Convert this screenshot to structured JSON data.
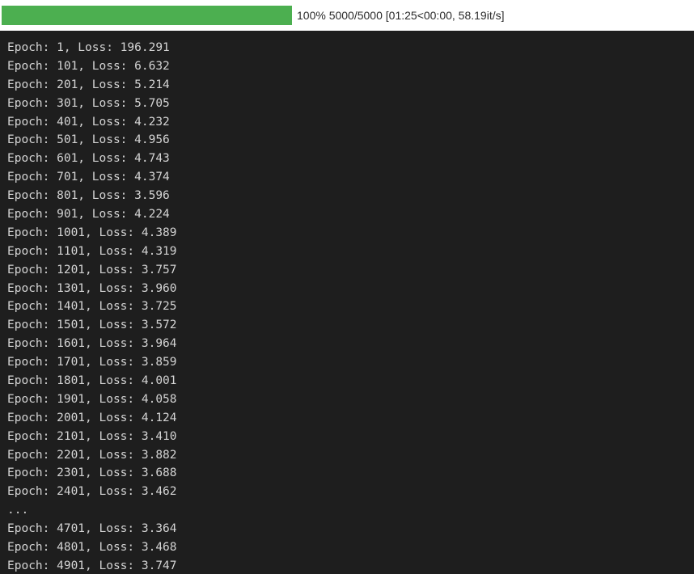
{
  "progress": {
    "percent": 100,
    "text": "100% 5000/5000 [01:25<00:00, 58.19it/s]",
    "bar_color": "#4caf50"
  },
  "output": {
    "background": "#1e1e1e",
    "text_color": "#d4d4d4",
    "lines": [
      "Epoch: 1, Loss: 196.291",
      "Epoch: 101, Loss: 6.632",
      "Epoch: 201, Loss: 5.214",
      "Epoch: 301, Loss: 5.705",
      "Epoch: 401, Loss: 4.232",
      "Epoch: 501, Loss: 4.956",
      "Epoch: 601, Loss: 4.743",
      "Epoch: 701, Loss: 4.374",
      "Epoch: 801, Loss: 3.596",
      "Epoch: 901, Loss: 4.224",
      "Epoch: 1001, Loss: 4.389",
      "Epoch: 1101, Loss: 4.319",
      "Epoch: 1201, Loss: 3.757",
      "Epoch: 1301, Loss: 3.960",
      "Epoch: 1401, Loss: 3.725",
      "Epoch: 1501, Loss: 3.572",
      "Epoch: 1601, Loss: 3.964",
      "Epoch: 1701, Loss: 3.859",
      "Epoch: 1801, Loss: 4.001",
      "Epoch: 1901, Loss: 4.058",
      "Epoch: 2001, Loss: 4.124",
      "Epoch: 2101, Loss: 3.410",
      "Epoch: 2201, Loss: 3.882",
      "Epoch: 2301, Loss: 3.688",
      "Epoch: 2401, Loss: 3.462",
      "...",
      "Epoch: 4701, Loss: 3.364",
      "Epoch: 4801, Loss: 3.468",
      "Epoch: 4901, Loss: 3.747"
    ]
  }
}
